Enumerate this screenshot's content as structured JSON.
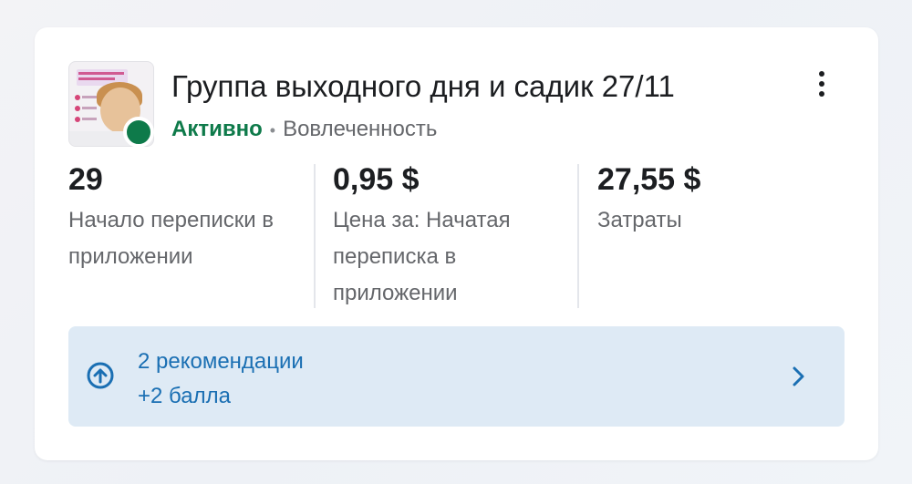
{
  "ad": {
    "title": "Группа выходного дня и садик 27/11",
    "status": "Активно",
    "separator": "•",
    "objective": "Вовлеченность",
    "thumbnail": "ad-creative-image",
    "status_color": "#0e7a4a"
  },
  "metrics": [
    {
      "value": "29",
      "label": "Начало переписки в приложении"
    },
    {
      "value": "0,95 $",
      "label": "Цена за: Начатая переписка в приложении"
    },
    {
      "value": "27,55 $",
      "label": "Затраты"
    }
  ],
  "recommendations": {
    "title": "2 рекомендации",
    "score": "+2 балла",
    "icon": "arrow-up-circle-icon",
    "accent": "#1a6fb3"
  },
  "menu": {
    "icon": "more-vertical-icon"
  }
}
